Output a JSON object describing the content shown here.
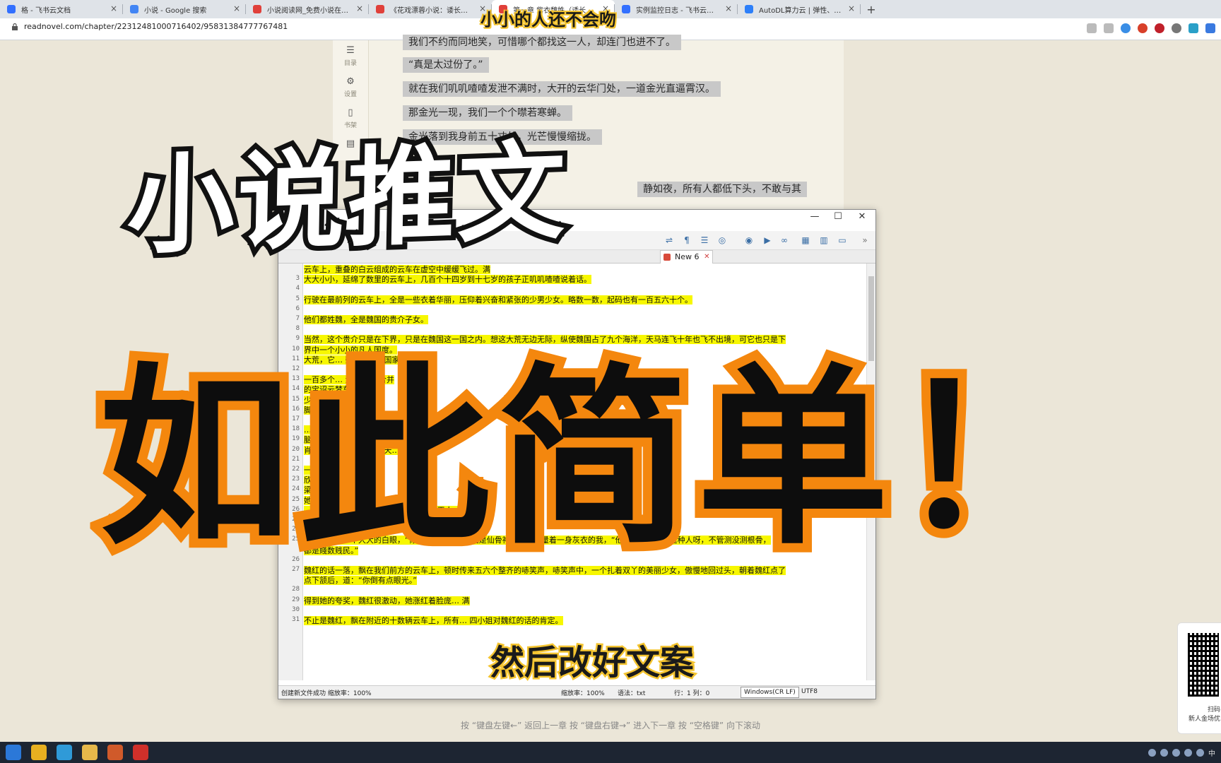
{
  "browser": {
    "tabs": [
      {
        "label": "格 - 飞书云文档",
        "favicon_color": "#3370ff"
      },
      {
        "label": "小说 - Google 搜索",
        "favicon_color": "#4285f4"
      },
      {
        "label": "小说阅读网_免费小说在线阅读_",
        "favicon_color": "#e0403a"
      },
      {
        "label": "《花戏漂蓉小说：诿长生》最新",
        "favicon_color": "#e0403a"
      },
      {
        "label": "第一章 紫衣魏姝（诿长生）",
        "favicon_color": "#e0403a",
        "active": true
      },
      {
        "label": "实例监控日志 - 飞书云文档",
        "favicon_color": "#3370ff"
      },
      {
        "label": "AutoDL算力云 | 弹性、好用、省",
        "favicon_color": "#2d7ff9"
      }
    ],
    "new_tab": "+",
    "url": "readnovel.com/chapter/22312481000716402/95831384777767481"
  },
  "sidebar": {
    "items": [
      {
        "icon": "list-icon",
        "label": "目录"
      },
      {
        "icon": "gear-icon",
        "label": "设置"
      },
      {
        "icon": "bookshelf-icon",
        "label": "书架"
      },
      {
        "icon": "document-icon",
        "label": ""
      }
    ]
  },
  "reader": {
    "paragraphs": [
      "我们不约而同地笑，可惜哪个都找这一人，却连门也进不了。",
      "“真是太过份了。”",
      "就在我们叽叽喳喳发泄不满时，大开的云华门处，一道金光直逼霄汉。",
      "那金光一现，我们一个个噤若寒蝉。",
      "金光落到我身前五十丈处，光芒慢慢缩拢。",
      "现在金光里",
      "静如夜，所有人都低下头，不敢与其"
    ],
    "hint": "按 “键盘左键←” 返回上一章  按 “键盘右键→” 进入下一章  按 “空格键” 向下滚动"
  },
  "qr_panel": {
    "line1": "扫码",
    "line2": "新人金场优"
  },
  "editor": {
    "window_controls": {
      "minimize": "—",
      "maximize": "☐",
      "close": "✕"
    },
    "tab_label": "New 6",
    "lines": [
      {
        "n": "",
        "text": "云车上，重叠的白云组成的云车在虚空中缓缓飞过。满"
      },
      {
        "n": "3",
        "text": "大大小小，延绵了数里的云车上，几百个十四岁到十七岁的孩子正叽叽喳喳说着话。"
      },
      {
        "n": "4",
        "text": ""
      },
      {
        "n": "5",
        "text": "行驶在最前列的云车上，全是一些衣着华丽，压仰着兴奋和紧张的少男少女。略数一数，起码也有一百五六十个。"
      },
      {
        "n": "6",
        "text": ""
      },
      {
        "n": "7",
        "text": "他们都姓魏，全是魏国的贵介子女。"
      },
      {
        "n": "8",
        "text": ""
      },
      {
        "n": "9",
        "text": "当然，这个贵介只是在下界，只是在魏国这一国之内。想这大荒无边无际，纵使魏国占了九个海洋，天马连飞十年也飞不出境，可它也只是下"
      },
      {
        "n": "10",
        "text": "界中一个小小的凡人国度。"
      },
      {
        "n": "11",
        "text": "大荒，它… 魏国这样的国家，"
      },
      {
        "n": "12",
        "text": ""
      },
      {
        "n": "13",
        "text": "一百多个… 浮在各… 合并"
      },
      {
        "n": "14",
        "text": "的宝诏云梦车…"
      },
      {
        "n": "15",
        "text": "少年们都… 这通往上"
      },
      {
        "n": "16",
        "text": "脚下… 去"
      },
      {
        "n": "17",
        "text": ""
      },
      {
        "n": "18",
        "text": "… 轮不… 门只能知"
      },
      {
        "n": "19",
        "text": "脑儿… 人显现世间 人都有"
      },
      {
        "n": "20",
        "text": "肖与… 择优秀者进入华天…"
      },
      {
        "n": "21",
        "text": ""
      },
      {
        "n": "22",
        "text": "一生… 只是"
      },
      {
        "n": "23",
        "text": "欣赏… 重重"
      },
      {
        "n": "24",
        "text": "梁… 你猜… 在上的"
      },
      {
        "n": "25",
        "text": "她… 一天…"
      },
      {
        "n": "26",
        "text": "… “仙典云，… 仙门，方能分辨賤数和天人。"
      },
      {
        "n": "27",
        "text": "，你等贱民 …  贵后，再激动罢。”"
      },
      {
        "n": "24",
        "text": ""
      },
      {
        "n": "25",
        "text": "魏红给了我一个大大的白眼，“你懂什么？良少肯定是仙骨神胎，”她打量着一身灰衣的我，“他可不像你，你这种人呀，不管测没测根骨，"
      },
      {
        "n": "",
        "text": "都是賤数贱民。”"
      },
      {
        "n": "26",
        "text": ""
      },
      {
        "n": "27",
        "text": "魏红的话一落，飘在我们前方的云车上，顿时传来五六个整齐的哧笑声，哧笑声中，一个扎着双丫的美丽少女，傲慢地回过头，朝着魏红点了"
      },
      {
        "n": "",
        "text": "点下颔后，道：“你倒有点眼光。”"
      },
      {
        "n": "28",
        "text": ""
      },
      {
        "n": "29",
        "text": "得到她的夸奖，魏红很激动，她涨红着脸庞…  满"
      },
      {
        "n": "30",
        "text": ""
      },
      {
        "n": "31",
        "text": "不止是魏红，飘在附近的十数辆云车上，所有… 四小姐对魏红的话的肯定。"
      }
    ],
    "status": {
      "message": "创建新文件成功 缩放率：100%",
      "zoom": "缩放率：100%",
      "language": "语法：txt",
      "position": "行：1 列：0",
      "line_ending": "Windows(CR LF)",
      "encoding": "UTF8"
    }
  },
  "overlay": {
    "channel_name": "小小的人还不会吻",
    "headline_top": "小说推文",
    "headline_main": "如此简单！",
    "subtitle": "然后改好文案"
  },
  "taskbar": {
    "apps": [
      {
        "icon": "windows-start-icon",
        "color": "#2b78d8"
      },
      {
        "icon": "chrome-icon",
        "color": "#e8b020"
      },
      {
        "icon": "typora-icon",
        "color": "#2f9ad8"
      },
      {
        "icon": "folder-icon",
        "color": "#e6b84a"
      },
      {
        "icon": "office-icon",
        "color": "#d05a2a"
      },
      {
        "icon": "app-red-icon",
        "color": "#d0302a"
      }
    ],
    "ime": "中"
  }
}
